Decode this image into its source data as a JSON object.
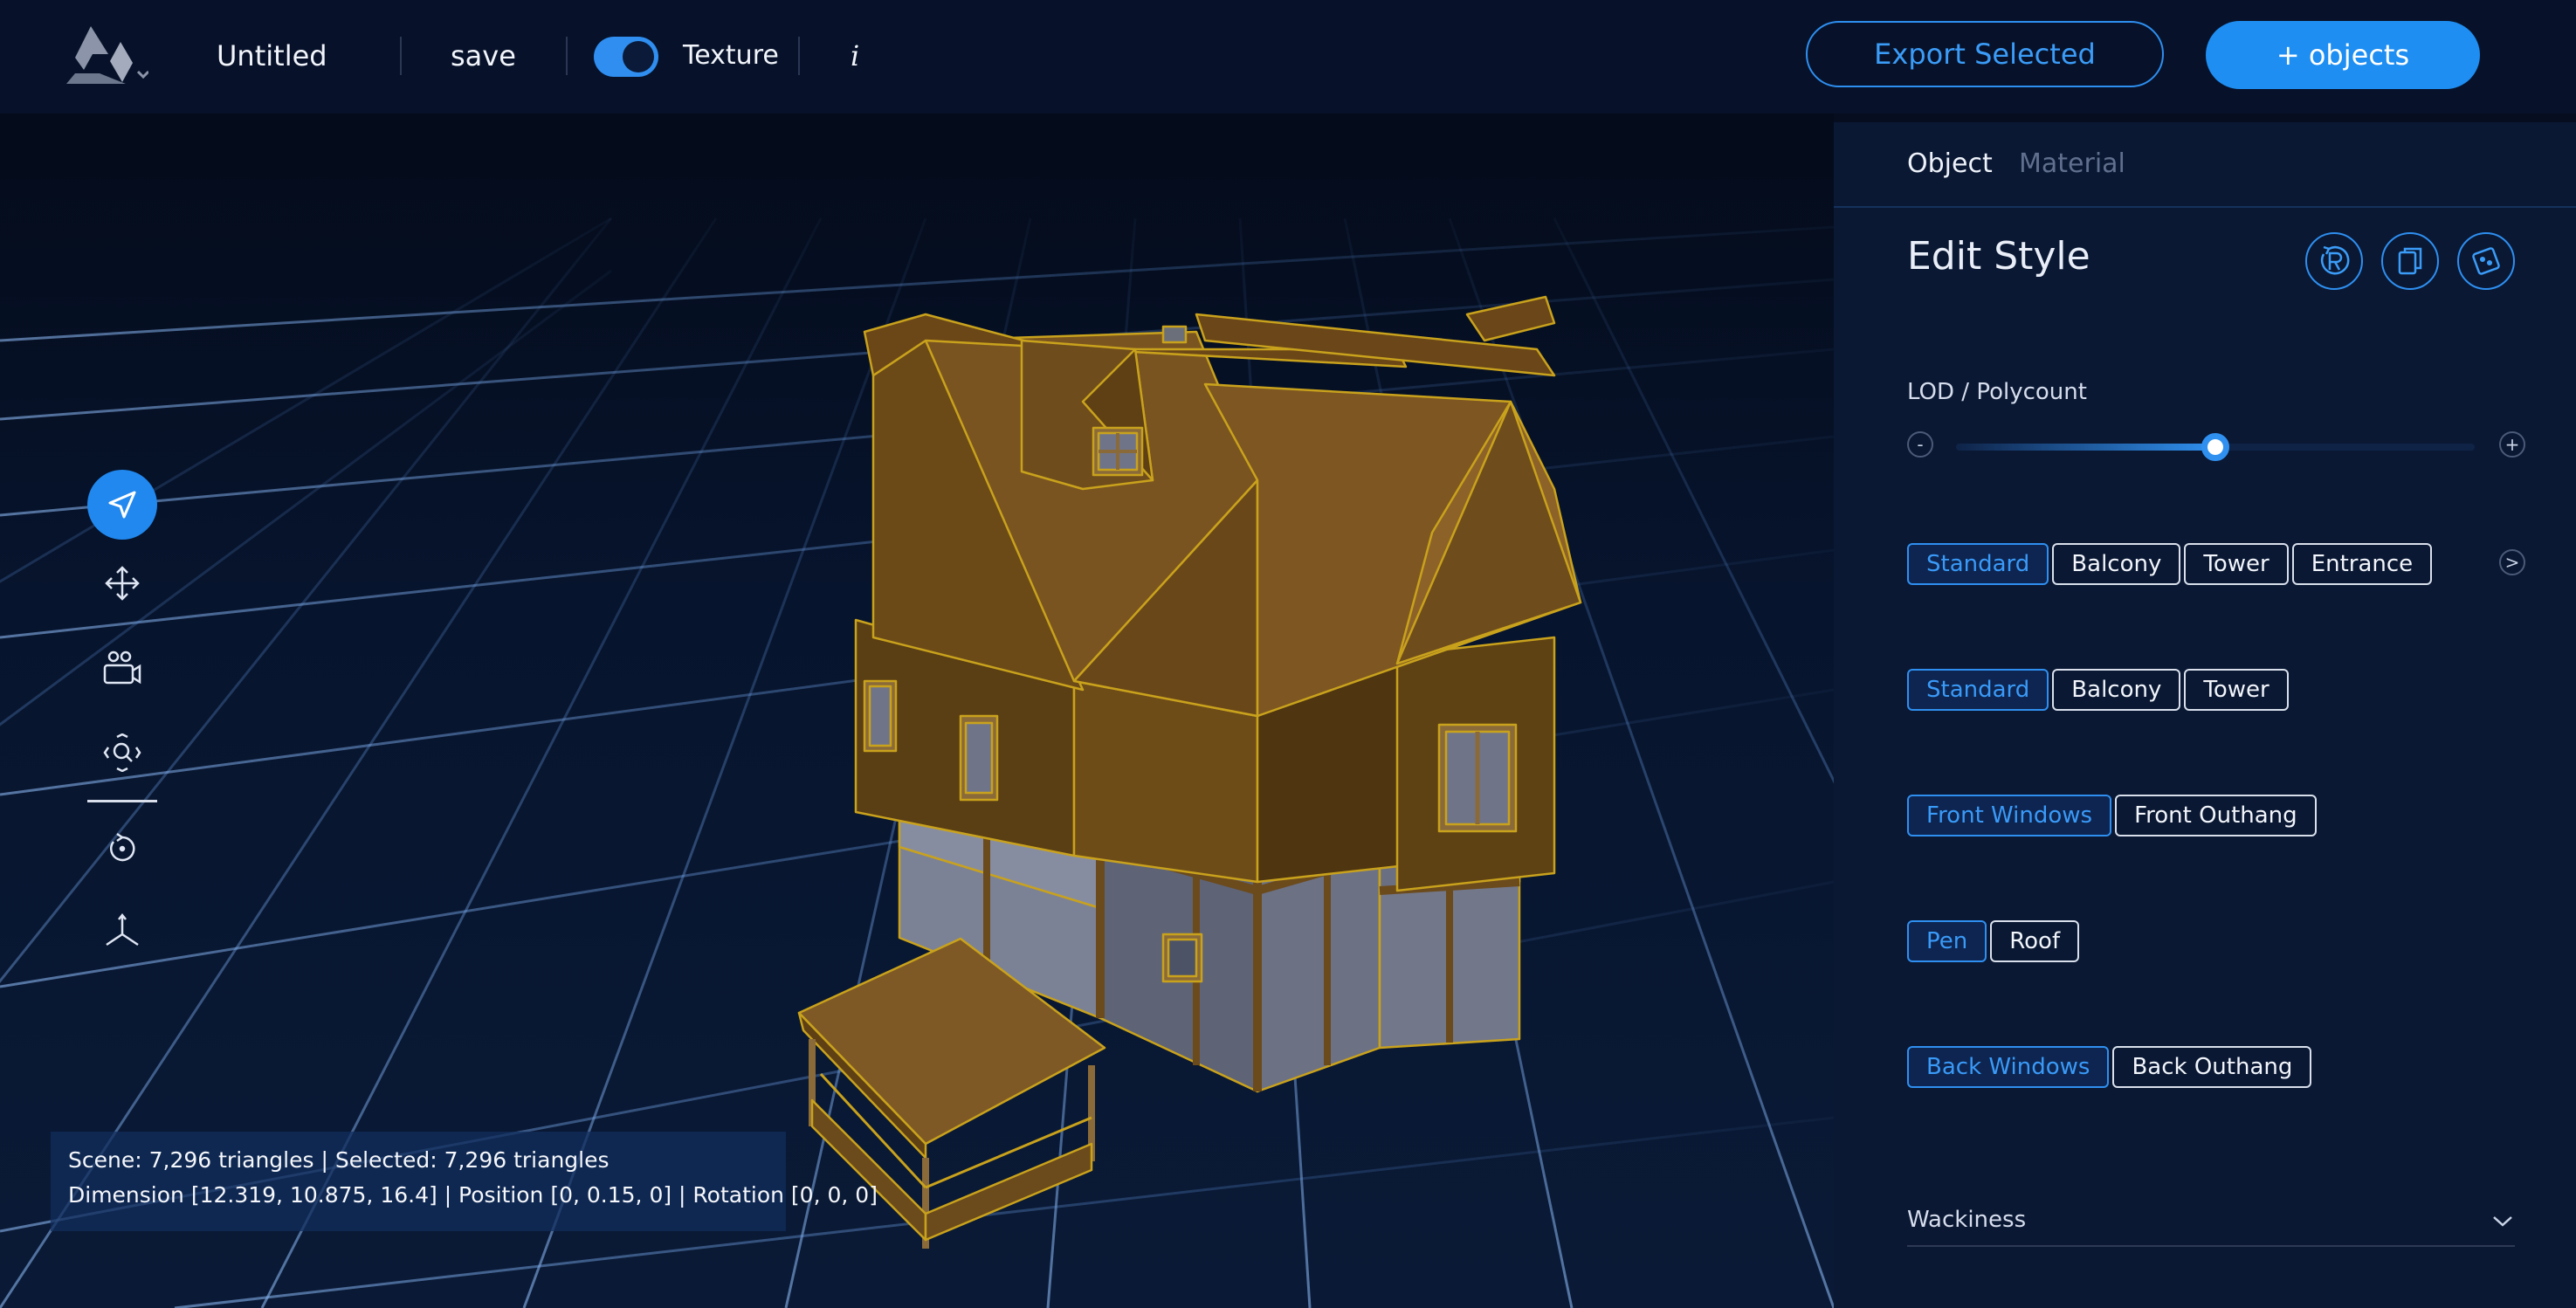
{
  "app": {
    "title": "Untitled",
    "save_label": "save",
    "texture_label": "Texture",
    "texture_on": true,
    "info_label": "i",
    "export_label": "Export Selected",
    "add_objects_label": "+ objects"
  },
  "colors": {
    "accent": "#2088ee",
    "background": "#050d1f",
    "panel": "#0a1833"
  },
  "toolbar": {
    "tools": [
      {
        "name": "select-tool",
        "icon": "navigation-arrow-icon",
        "active": true
      },
      {
        "name": "move-tool",
        "icon": "move-arrows-icon",
        "active": false
      },
      {
        "name": "camera-tool",
        "icon": "camera-people-icon",
        "active": false
      },
      {
        "name": "zoom-tool",
        "icon": "zoom-search-icon",
        "active": false
      },
      {
        "name": "rotate-tool",
        "icon": "rotate-icon",
        "active": false
      },
      {
        "name": "axis-tool",
        "icon": "axis-icon",
        "active": false
      }
    ]
  },
  "stats": {
    "line1": "Scene: 7,296 triangles | Selected: 7,296 triangles",
    "line2": "Dimension [12.319, 10.875, 16.4] | Position [0, 0.15, 0] | Rotation [0, 0, 0]"
  },
  "panel": {
    "tabs": [
      {
        "label": "Object",
        "active": true
      },
      {
        "label": "Material",
        "active": false
      }
    ],
    "edit_title": "Edit Style",
    "actions": [
      "reset-icon",
      "copy-icon",
      "dice-icon"
    ],
    "lod_label": "LOD / Polycount",
    "lod_value": 0.5,
    "lod_minus": "-",
    "lod_plus": "+",
    "next_arrow": ">",
    "rows": [
      {
        "options": [
          "Standard",
          "Balcony",
          "Tower",
          "Entrance"
        ],
        "selected": 0
      },
      {
        "options": [
          "Standard",
          "Balcony",
          "Tower"
        ],
        "selected": 0
      },
      {
        "options": [
          "Front Windows",
          "Front Outhang"
        ],
        "selected": 0
      },
      {
        "options": [
          "Pen",
          "Roof"
        ],
        "selected": 0
      },
      {
        "options": [
          "Back Windows",
          "Back Outhang"
        ],
        "selected": 0
      }
    ],
    "wackiness_label": "Wackiness"
  }
}
